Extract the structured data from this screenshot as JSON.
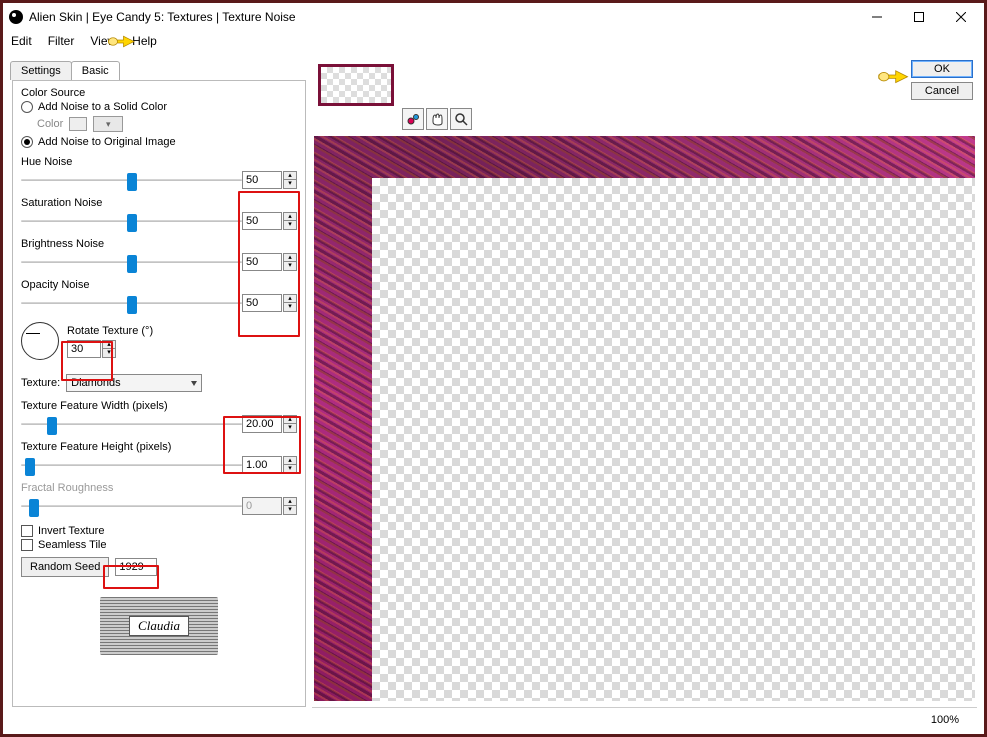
{
  "window": {
    "title": "Alien Skin | Eye Candy 5: Textures | Texture Noise"
  },
  "menubar": {
    "items": [
      "Edit",
      "Filter",
      "View",
      "Help"
    ]
  },
  "tabs": {
    "settings": "Settings",
    "basic": "Basic"
  },
  "panel": {
    "color_source_label": "Color Source",
    "radio_solid": "Add Noise to a Solid Color",
    "color_label": "Color",
    "radio_original": "Add Noise to Original Image",
    "hue_noise": {
      "label": "Hue Noise",
      "value": "50",
      "pos": 50
    },
    "sat_noise": {
      "label": "Saturation Noise",
      "value": "50",
      "pos": 50
    },
    "bright_noise": {
      "label": "Brightness Noise",
      "value": "50",
      "pos": 50
    },
    "opacity_noise": {
      "label": "Opacity Noise",
      "value": "50",
      "pos": 50
    },
    "rotate": {
      "label": "Rotate Texture (°)",
      "value": "30"
    },
    "texture": {
      "label": "Texture:",
      "value": "Diamonds"
    },
    "feat_width": {
      "label": "Texture Feature Width (pixels)",
      "value": "20.00",
      "pos": 14
    },
    "feat_height": {
      "label": "Texture Feature Height (pixels)",
      "value": "1.00",
      "pos": 4
    },
    "fractal": {
      "label": "Fractal Roughness",
      "value": "0",
      "pos": 6
    },
    "invert": "Invert Texture",
    "seamless": "Seamless Tile",
    "seed_btn": "Random Seed",
    "seed_value": "1929",
    "watermark": "Claudia"
  },
  "buttons": {
    "ok": "OK",
    "cancel": "Cancel"
  },
  "status": {
    "zoom": "100%"
  }
}
